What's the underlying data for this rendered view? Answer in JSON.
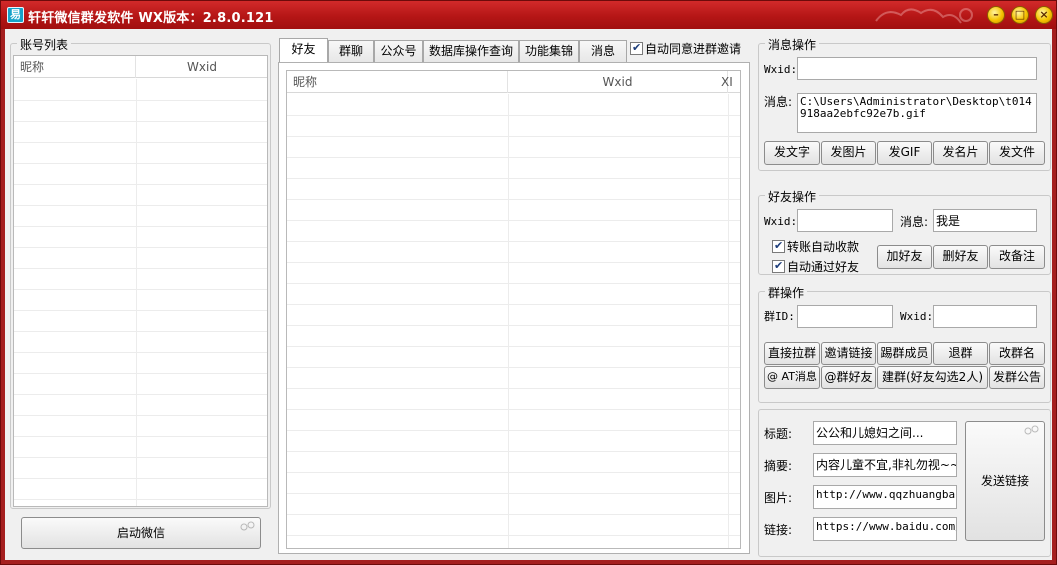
{
  "window": {
    "title": "轩轩微信群发软件  WX版本：2.8.0.121",
    "icon_letter": "易",
    "controls": {
      "minimize": "–",
      "maximize": "□",
      "close": "×"
    }
  },
  "account_panel": {
    "label": "账号列表",
    "columns": [
      "昵称",
      "Wxid"
    ],
    "start_button": "启动微信"
  },
  "tabs": [
    {
      "label": "好友",
      "active": true
    },
    {
      "label": "群聊"
    },
    {
      "label": "公众号"
    },
    {
      "label": "数据库操作查询"
    },
    {
      "label": "功能集锦"
    },
    {
      "label": "消息"
    }
  ],
  "auto_accept": {
    "label": "自动同意进群邀请",
    "checked": true
  },
  "friend_grid": {
    "columns": [
      "昵称",
      "Wxid",
      "XI"
    ]
  },
  "message_ops": {
    "label": "消息操作",
    "wxid_label": "Wxid:",
    "wxid_value": "",
    "message_label": "消息:",
    "message_value": "C:\\Users\\Administrator\\Desktop\\t014918aa2ebfc92e7b.gif",
    "buttons": [
      "发文字",
      "发图片",
      "发GIF",
      "发名片",
      "发文件"
    ]
  },
  "friend_ops": {
    "label": "好友操作",
    "wxid_label": "Wxid:",
    "wxid_value": "",
    "message_label": "消息:",
    "message_value": "我是",
    "auto_collect": {
      "label": "转账自动收款",
      "checked": true
    },
    "auto_accept_friend": {
      "label": "自动通过好友",
      "checked": true
    },
    "buttons": [
      "加好友",
      "删好友",
      "改备注"
    ]
  },
  "group_ops": {
    "label": "群操作",
    "groupid_label": "群ID:",
    "groupid_value": "",
    "wxid_label": "Wxid:",
    "wxid_value": "",
    "row1_buttons": [
      "直接拉群",
      "邀请链接",
      "踢群成员",
      "退群",
      "改群名"
    ],
    "row2_buttons": [
      "@ AT消息",
      "@群好友",
      "建群(好友勾选2人)",
      "发群公告"
    ]
  },
  "link_panel": {
    "title_label": "标题:",
    "title_value": "公公和儿媳妇之间...",
    "summary_label": "摘要:",
    "summary_value": "内容儿童不宜,非礼勿视~~",
    "image_label": "图片:",
    "image_value": "http://www.qqzhuangban.c",
    "link_label": "链接:",
    "link_value": "https://www.baidu.com/",
    "send_button": "发送链接"
  }
}
